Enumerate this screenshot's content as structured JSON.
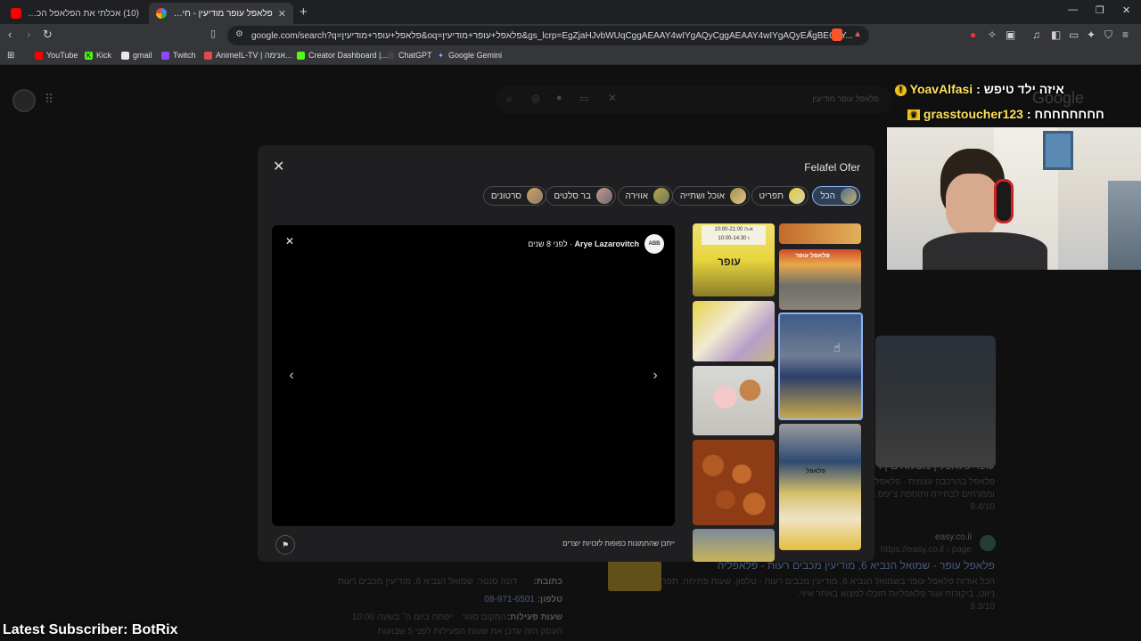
{
  "browser": {
    "tabs": [
      {
        "title": "(10) אכלתי את הפלאפל הכי ישן בישר",
        "active": false
      },
      {
        "title": "פלאפל עופר מודיעין - חיפוש ב-Google",
        "active": true
      }
    ],
    "url": "google.com/search?q=פלאפל+עופר+מודיעין&oq=פלאפל+עופר+מודיעין&gs_lcrp=EgZjaHJvbWUqCggAEAAY4wIYgAQyCggAEAAY4wIYgAQyEAgBEC4Y...",
    "bookmarks": [
      {
        "label": "YouTube",
        "icon": "youtube-icon",
        "color": "#ff0000"
      },
      {
        "label": "Kick",
        "icon": "kick-icon",
        "color": "#53fc18"
      },
      {
        "label": "gmail",
        "icon": "gmail-icon",
        "color": "#e8e8e8"
      },
      {
        "label": "Twitch",
        "icon": "twitch-icon",
        "color": "#9146ff"
      },
      {
        "label": "AnimeIL-TV | אנימה...",
        "icon": "animeil-icon",
        "color": "#e24a4a"
      },
      {
        "label": "Creator Dashboard |...",
        "icon": "creator-dashboard-icon",
        "color": "#53fc18"
      },
      {
        "label": "ChatGPT",
        "icon": "chatgpt-icon",
        "color": "#dddddd"
      },
      {
        "label": "Google Gemini",
        "icon": "gemini-icon",
        "color": "#8ab4f8"
      }
    ]
  },
  "google": {
    "logo": "Google",
    "search_query": "פלאפל עופר מודיעין",
    "result_links": [
      {
        "source": "Wolt",
        "url": "https://wolt.com › Wolt",
        "title": "עופר פלאפל | משלוחים | ו",
        "snippet": "פלאפל בהרכבה עצמית · פלאפל מפו",
        "snippet2": "וממרחים לבחירה ותוספת צ'יפס. 00 ₪",
        "rating": "9.4/10",
        "reviews": "(100)",
        "extra": "טווח מחירים"
      },
      {
        "source": "easy.co.il",
        "url": "https://easy.co.il › page",
        "title": "פלאפל עופר - שמואל הנביא 6, מודיעין מכבים רעות - פלאפליה",
        "snippet": "הכל אודות פלאפל עופר בשמואל הנביא 6, מודיעין מכבים רעות - טלפון, שעות פתיחה, תפריט,",
        "snippet2": "ניווט, ביקורות ועוד פלאפליות תוכלו למצוא באתר איזי.",
        "rating": "9.3/10",
        "reviews": "(2,147)",
        "extra": "טווח מחירים: ₪"
      }
    ],
    "knowledge_panel": {
      "address_label": "כתובת:",
      "address_value": "דונה סנטר, שמואל הנביא 6, מודיעין מכבים רעות",
      "phone_label": "טלפון:",
      "phone_value": "08-971-6501",
      "hours_label": "שעות פעילות:",
      "hours_value": "המקום סגור · ייפתח ביום ה׳ בשעה 10:00",
      "hours_note": "העסק הזה עדכן את שעות הפעילות לפני 5 שבועות"
    }
  },
  "viewer": {
    "place_title": "Felafel Ofer",
    "chips": [
      {
        "label": "הכל",
        "selected": true
      },
      {
        "label": "תפריט",
        "selected": false
      },
      {
        "label": "אוכל ושתייה",
        "selected": false
      },
      {
        "label": "אווירה",
        "selected": false
      },
      {
        "label": "בר סלטים",
        "selected": false
      },
      {
        "label": "סרטונים",
        "selected": false
      }
    ],
    "author_name": "Arye Lazarovitch",
    "author_time": "לפני 8 שנים",
    "author_logo_text": "ABB",
    "disclaimer": "ייתכן שהתמונות כפופות לזכויות יוצרים",
    "thumb_sign_text": "עופר",
    "thumb_hours_1": "10:00-21:00 א-ה",
    "thumb_hours_2": "10:00-14:30 ו",
    "thumb_sign_text2": "פלאפל עופר",
    "thumb_box_text": "פלאפל"
  },
  "stream": {
    "chat": [
      {
        "user": "YoavAlfasi",
        "message": "איזה ילד טיפש",
        "badge": "coin-badge-icon"
      },
      {
        "user": "grasstoucher123",
        "message": "חחחחחחחח",
        "badge": "crown-badge-icon"
      }
    ],
    "latest_subscriber": "Latest Subscriber: BotRix"
  }
}
